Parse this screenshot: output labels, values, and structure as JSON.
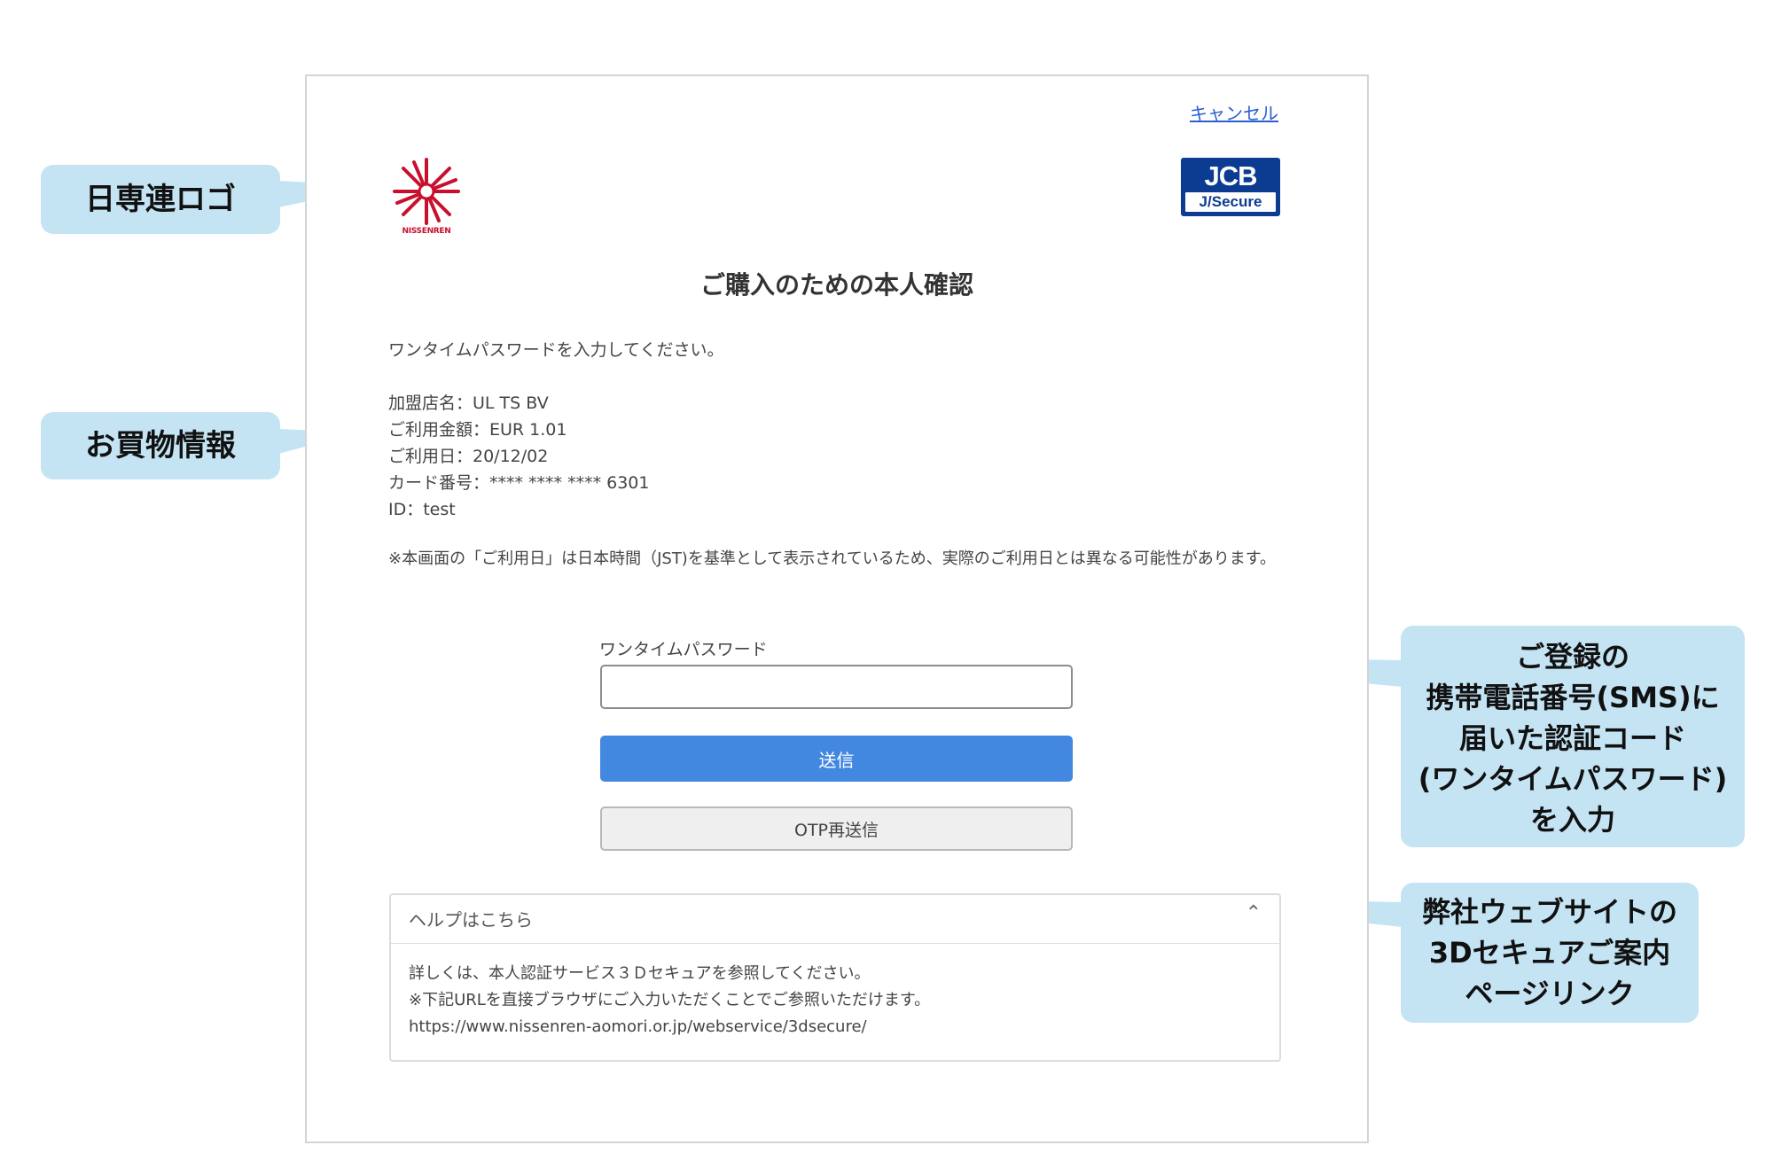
{
  "page": {
    "cancel_link": "キャンセル",
    "title": "ご購入のための本人確認",
    "instruction": "ワンタイムパスワードを入力してください。",
    "merchant_logo_text": "NISSENREN",
    "jcb_logo": {
      "top": "JCB",
      "bottom": "J/Secure"
    },
    "purchase_info": {
      "merchant": "加盟店名：UL TS BV",
      "amount": "ご利用金額：EUR 1.01",
      "date": "ご利用日：20/12/02",
      "card_number": "カード番号：**** **** **** 6301",
      "id": "ID：test"
    },
    "note": "※本画面の「ご利用日」は日本時間（JST)を基準として表示されているため、実際のご利用日とは異なる可能性があります。",
    "otp": {
      "label": "ワンタイムパスワード",
      "value": "",
      "submit_label": "送信",
      "resend_label": "OTP再送信"
    },
    "help": {
      "title": "ヘルプはこちら",
      "toggle_icon": "⌃",
      "line1": "詳しくは、本人認証サービス３Ｄセキュアを参照してください。",
      "line2": "※下記URLを直接ブラウザにご入力いただくことでご参照いただけます。",
      "url": "https://www.nissenren-aomori.or.jp/webservice/3dsecure/"
    }
  },
  "callouts": {
    "logo": "日専連ロゴ",
    "shopping": "お買物情報",
    "otp": [
      "ご登録の",
      "携帯電話番号(SMS)に",
      "届いた認証コード",
      "(ワンタイムパスワード)",
      "を入力"
    ],
    "help": [
      "弊社ウェブサイトの",
      "3Dセキュアご案内",
      "ページリンク"
    ]
  },
  "colors": {
    "callout_bg": "#c4e4f4",
    "submit_bg": "#4287e0",
    "link": "#2a5fd0",
    "logo_red": "#c8102e",
    "jcb_blue": "#0b3c91"
  }
}
